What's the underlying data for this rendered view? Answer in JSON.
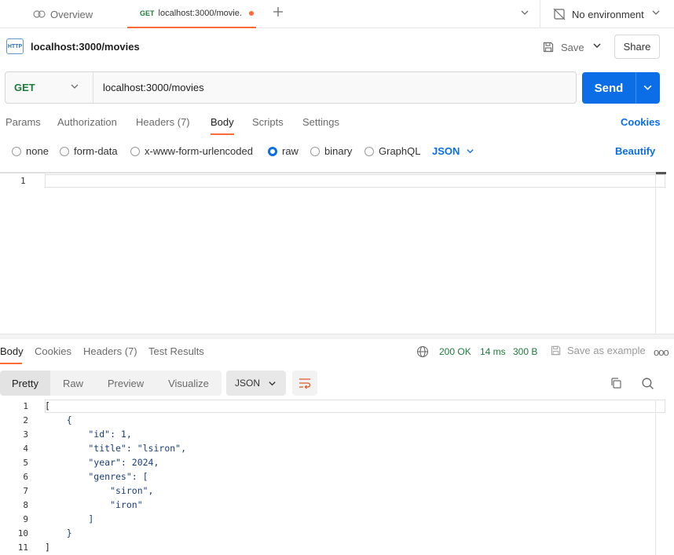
{
  "tabs": {
    "overview_label": "Overview",
    "active_method": "GET",
    "active_label": "localhost:3000/movie."
  },
  "environment": {
    "label": "No environment"
  },
  "request": {
    "name": "localhost:3000/movies",
    "badge": "HTTP",
    "save_label": "Save",
    "share_label": "Share",
    "method": "GET",
    "url": "localhost:3000/movies",
    "send_label": "Send"
  },
  "request_tabs": {
    "params": "Params",
    "authorization": "Authorization",
    "headers": "Headers (7)",
    "body": "Body",
    "scripts": "Scripts",
    "settings": "Settings",
    "cookies": "Cookies"
  },
  "body_types": {
    "none": "none",
    "form_data": "form-data",
    "urlencoded": "x-www-form-urlencoded",
    "raw": "raw",
    "binary": "binary",
    "graphql": "GraphQL",
    "format": "JSON",
    "beautify": "Beautify",
    "selected": "raw"
  },
  "request_editor": {
    "line_numbers": [
      "1"
    ]
  },
  "response_tabs": {
    "body": "Body",
    "cookies": "Cookies",
    "headers": "Headers (7)",
    "test_results": "Test Results"
  },
  "response_meta": {
    "status": "200 OK",
    "time": "14 ms",
    "size": "300 B",
    "save_example": "Save as example",
    "more": "ooo"
  },
  "response_view": {
    "pretty": "Pretty",
    "raw": "Raw",
    "preview": "Preview",
    "visualize": "Visualize",
    "format": "JSON"
  },
  "response_code": {
    "line_numbers": [
      "1",
      "2",
      "3",
      "4",
      "5",
      "6",
      "7",
      "8",
      "9",
      "10",
      "11"
    ],
    "lines": [
      "[",
      "    {",
      "        \"id\": 1,",
      "        \"title\": \"lsiron\",",
      "        \"year\": 2024,",
      "        \"genres\": [",
      "            \"siron\",",
      "            \"iron\"",
      "        ]",
      "    }",
      "]"
    ]
  },
  "colors": {
    "accent": "#ff6c37",
    "primary": "#0b6ee6",
    "method_get": "#1e7b3c",
    "status_ok": "#1e7b3c"
  }
}
